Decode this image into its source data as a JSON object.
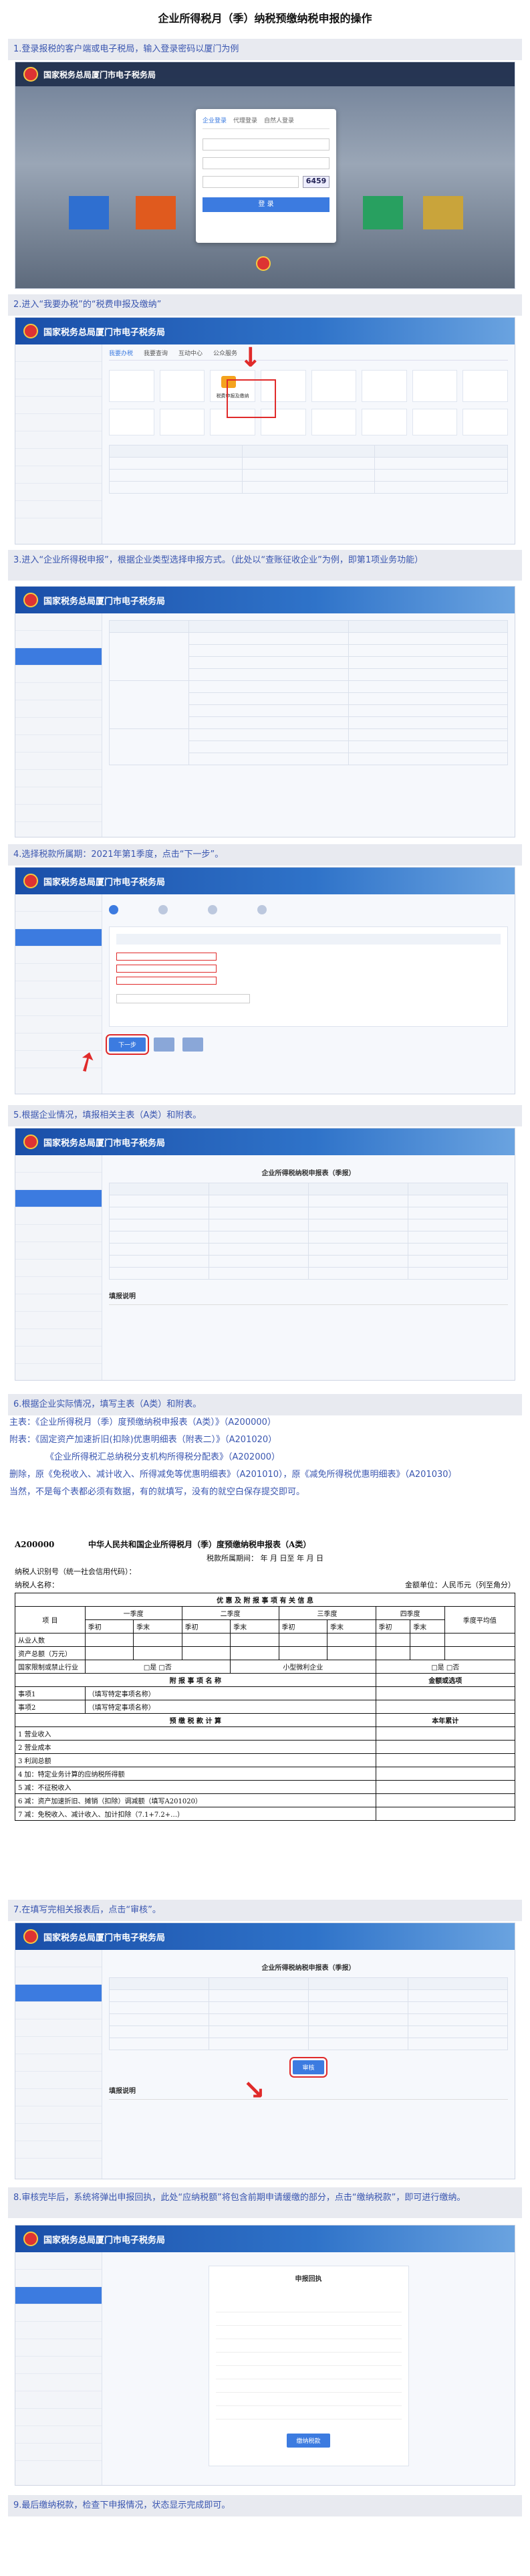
{
  "page_title": "企业所得税月（季）纳税预缴纳税申报的操作",
  "steps": [
    "1.登录报税的客户端或电子税局，输入登录密码以厦门为例",
    "2.进入“我要办税”的“税费申报及缴纳”",
    "3.进入“企业所得税申报”，根据企业类型选择申报方式。（此处以“查账征收企业”为例，即第1项业务功能）",
    "4.选择税款所属期：2021年第1季度，点击“下一步”。",
    "5.根据企业情况，填报相关主表（A类）和附表。",
    "6.根据企业实际情况，填写主表（A类）和附表。",
    "7.在填写完相关报表后，点击“审核”。",
    "8.审核完毕后，系统将弹出申报回执，此处“应纳税额”将包含前期申请缓缴的部分，点击“缴纳税款”，即可进行缴纳。",
    "9.最后缴纳税款，检查下申报情况，状态显示完成即可。"
  ],
  "portal_name": "国家税务总局厦门市电子税务局",
  "login": {
    "tabs": [
      "企业登录",
      "代理登录",
      "自然人登录"
    ],
    "button": "登 录",
    "captcha": "6459"
  },
  "tiles": {
    "main": [
      "我要办税",
      "我要查询",
      "互动中心",
      "公众服务"
    ],
    "highlighted": "税费申报及缴纳"
  },
  "step6_lines": [
    "主表：《企业所得税月（季）度预缴纳税申报表（A类）》（A200000）",
    "附表：《固定资产加速折旧(扣除)优惠明细表（附表二）》（A201020）",
    "《企业所得税汇总纳税分支机构所得税分配表》（A202000）",
    "删除，原《免税收入、减计收入、所得减免等优惠明细表》（A201010），原《减免所得税优惠明细表》（A201030）",
    "当然，不是每个表都必须有数据，有的就填写，没有的就空白保存提交即可。"
  ],
  "form": {
    "code": "A200000",
    "heading": "中华人民共和国企业所得税月（季）度预缴纳税申报表（A类）",
    "period": "税款所属期间：    年  月  日至    年  月  日",
    "taxpayer_id": "纳税人识别号（统一社会信用代码）：",
    "taxpayer_name": "纳税人名称：",
    "unit": "金额单位：人民币元（列至角分）",
    "section1": "优 惠 及 附 报 事 项 有 关 信 息",
    "quarters": [
      "一季度",
      "二季度",
      "三季度",
      "四季度"
    ],
    "quarter_cols": [
      "季初",
      "季末"
    ],
    "avg_col": "季度平均值",
    "rows_info": [
      "从业人数",
      "资产总额（万元）",
      "国家限制或禁止行业",
      "小型微利企业"
    ],
    "yes_no": "□是 □否",
    "section2": "附 报 事 项 名 称",
    "amount_col": "金额或选项",
    "items": [
      "事项1",
      "事项2"
    ],
    "items_hint": [
      "（填写特定事项名称）",
      "（填写特定事项名称）"
    ],
    "section3": "预 缴 税 款 计 算",
    "total_col": "本年累计",
    "calc_rows": [
      "1  营业收入",
      "2  营业成本",
      "3  利润总额",
      "4  加：特定业务计算的应纳税所得额",
      "5  减：不征税收入",
      "6  减：资产加速折旧、摊销（扣除）调减额（填写A201020）",
      "7  减：免税收入、减计收入、加计扣除（7.1+7.2+…）"
    ]
  },
  "buttons": {
    "next": "下一步",
    "audit": "审核",
    "pay": "缴纳税款"
  },
  "report_title": "企业所得税纳税申报表（季报）",
  "notice_title": "填报说明",
  "receipt_title": "申报回执"
}
